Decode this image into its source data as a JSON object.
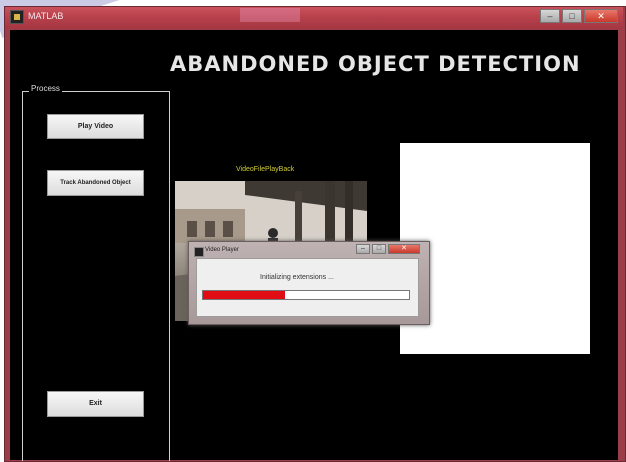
{
  "window": {
    "title": "MATLAB",
    "controls": {
      "minimize": "–",
      "maximize": "□",
      "close": "✕"
    }
  },
  "app": {
    "main_title": "ABANDONED OBJECT DETECTION",
    "process_panel": {
      "title": "Process",
      "buttons": {
        "play_video": "Play Video",
        "track_object": "Track Abandoned Object",
        "exit": "Exit"
      }
    },
    "video_label": "VideoFilePlayBack"
  },
  "dialog": {
    "title": "Video Player",
    "message": "Initializing extensions ...",
    "progress": 0.4
  },
  "colors": {
    "background": "#000000",
    "title_text": "#e6e6e6",
    "video_label": "#d4cf3a",
    "progress_fill": "#e00e14",
    "window_frame": "#b8414c"
  },
  "icons": [
    "app-icon",
    "dialog-app-icon"
  ]
}
